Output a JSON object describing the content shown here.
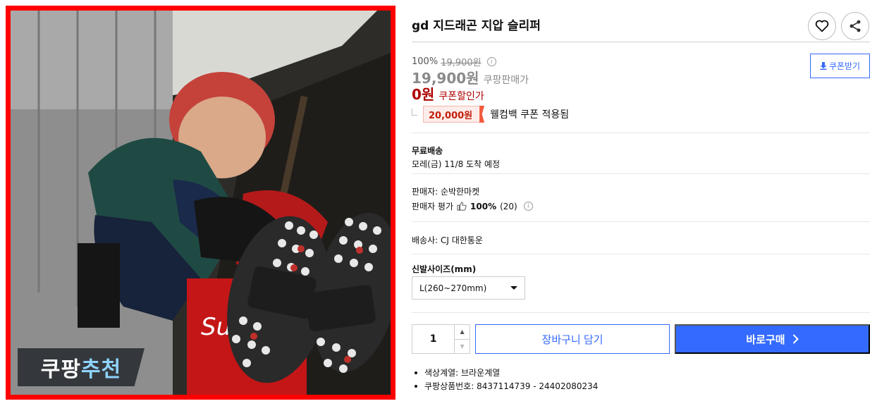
{
  "product": {
    "title": "gd 지드래곤 지압 슬리퍼",
    "image_badge": {
      "part1": "쿠팡",
      "part2": "추천"
    }
  },
  "actions": {
    "wishlist_icon": "heart-icon",
    "share_icon": "share-icon"
  },
  "price": {
    "discount_rate": "100%",
    "original_price": "19,900원",
    "sale_price": "19,900원",
    "sale_label": "쿠팡판매가",
    "final_price": "0원",
    "final_label": "쿠폰할인가",
    "welcome_cash": "20,000원",
    "welcome_text": "웰컴백 쿠폰 적용됨",
    "coupon_button": "쿠폰받기"
  },
  "shipping": {
    "title": "무료배송",
    "eta": "모레(금) 11/8 도착 예정"
  },
  "seller": {
    "name": "판매자: 순박한마켓",
    "rating_label": "판매자 평가",
    "rating_value": "100%",
    "rating_count": "(20)"
  },
  "carrier": "배송사: CJ 대한통운",
  "option": {
    "label": "신발사이즈(mm)",
    "selected": "L(260~270mm)"
  },
  "purchase": {
    "quantity": "1",
    "qty_up": "▲",
    "qty_down": "▼",
    "cart_button": "장바구니 담기",
    "buy_button": "바로구매"
  },
  "specs": [
    "색상계열: 브라운계열",
    "쿠팡상품번호: 8437114739 - 24402080234"
  ],
  "colors": {
    "accent": "#346aff",
    "sale_red": "#ae0000",
    "frame_red": "#ff0000"
  }
}
